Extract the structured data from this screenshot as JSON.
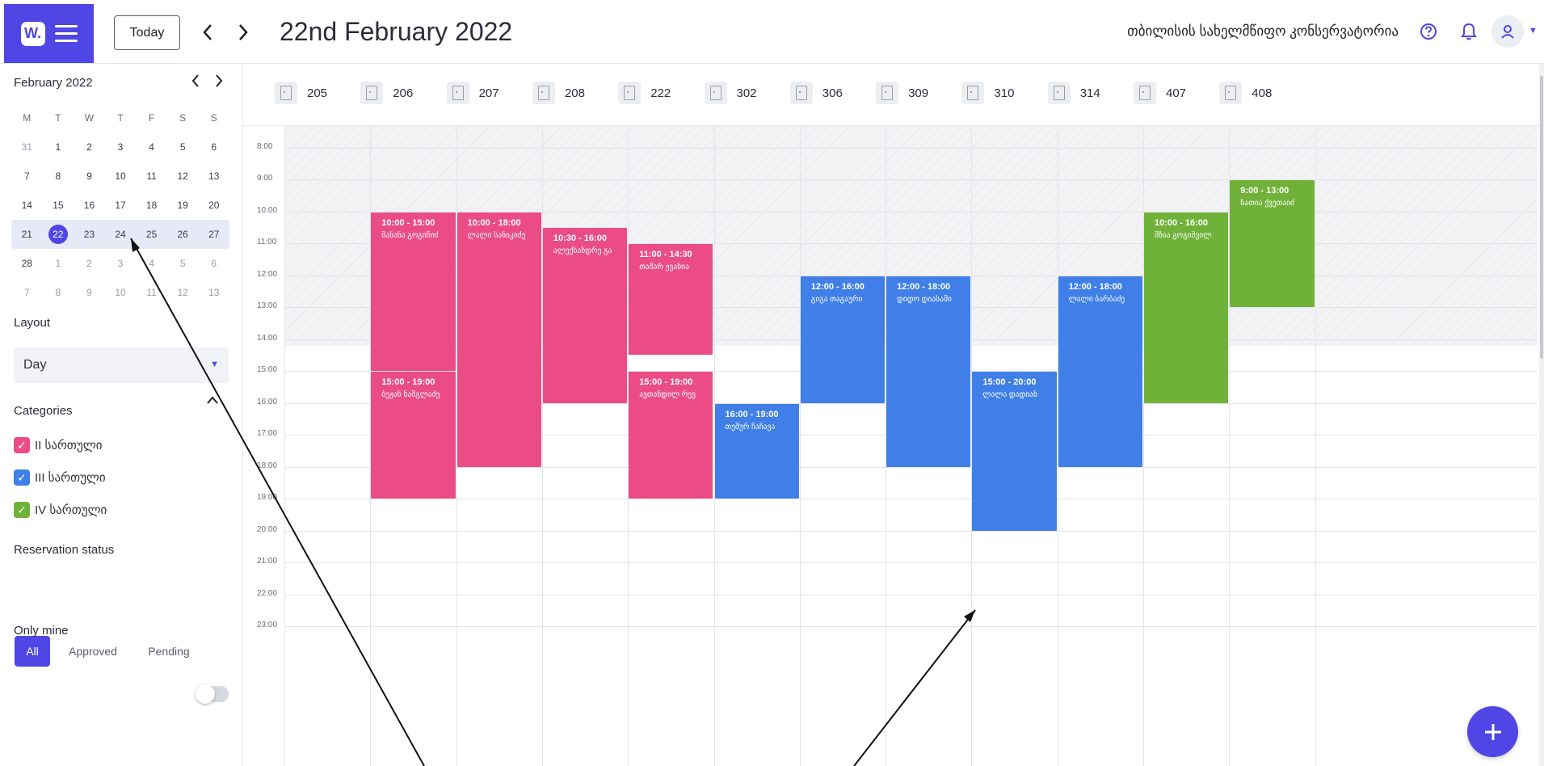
{
  "header": {
    "today_label": "Today",
    "date_title": "22nd February 2022",
    "org_name": "თბილისის სახელმწიფო კონსერვატორია",
    "icons": [
      "logo-icon",
      "menu-icon",
      "chevron-left-icon",
      "chevron-right-icon",
      "help-icon",
      "bell-icon",
      "user-icon"
    ]
  },
  "mini_calendar": {
    "month_title": "February 2022",
    "weekdays": [
      "M",
      "T",
      "W",
      "T",
      "F",
      "S",
      "S"
    ],
    "weeks": [
      [
        "31",
        "1",
        "2",
        "3",
        "4",
        "5",
        "6"
      ],
      [
        "7",
        "8",
        "9",
        "10",
        "11",
        "12",
        "13"
      ],
      [
        "14",
        "15",
        "16",
        "17",
        "18",
        "19",
        "20"
      ],
      [
        "21",
        "22",
        "23",
        "24",
        "25",
        "26",
        "27"
      ],
      [
        "28",
        "1",
        "2",
        "3",
        "4",
        "5",
        "6"
      ],
      [
        "7",
        "8",
        "9",
        "10",
        "11",
        "12",
        "13"
      ]
    ],
    "selected": "22"
  },
  "layout": {
    "label": "Layout",
    "value": "Day"
  },
  "categories": {
    "label": "Categories",
    "items": [
      {
        "label": "II სართული",
        "color": "#ec4c85"
      },
      {
        "label": "III სართული",
        "color": "#3f7fe7"
      },
      {
        "label": "IV სართული",
        "color": "#70b239"
      }
    ]
  },
  "reservation_status": {
    "label": "Reservation status",
    "options": [
      "All",
      "Approved",
      "Pending"
    ],
    "active": "All"
  },
  "only_mine": {
    "label": "Only mine",
    "on": false
  },
  "rooms": [
    "205",
    "206",
    "207",
    "208",
    "222",
    "302",
    "306",
    "309",
    "310",
    "314",
    "407",
    "408"
  ],
  "time_labels": [
    "8:00",
    "9:00",
    "10:00",
    "11:00",
    "12:00",
    "13:00",
    "14:00",
    "15:00",
    "16:00",
    "17:00",
    "18:00",
    "19:00",
    "20:00",
    "21:00",
    "22:00",
    "23:00"
  ],
  "events": [
    {
      "room": "206",
      "start": "10:00",
      "end": "15:00",
      "name": "მანანა გოგიჩიძ",
      "category": "II სართული"
    },
    {
      "room": "206",
      "start": "15:00",
      "end": "19:00",
      "name": "ბეჟან ნამგლაძე",
      "category": "II სართული"
    },
    {
      "room": "207",
      "start": "10:00",
      "end": "18:00",
      "name": "ლალი სანიკიძე",
      "category": "II სართული"
    },
    {
      "room": "208",
      "start": "10:30",
      "end": "16:00",
      "name": "ალექსანდრე გა",
      "category": "II სართული"
    },
    {
      "room": "222",
      "start": "11:00",
      "end": "14:30",
      "name": "თამარ ჟვანია",
      "category": "II სართული"
    },
    {
      "room": "222",
      "start": "15:00",
      "end": "19:00",
      "name": "ავთანდილ რევ",
      "category": "II სართული"
    },
    {
      "room": "302",
      "start": "16:00",
      "end": "19:00",
      "name": "თემურ ჩაჩავა",
      "category": "III სართული"
    },
    {
      "room": "306",
      "start": "12:00",
      "end": "16:00",
      "name": "გიგა თაგაური",
      "category": "III სართული"
    },
    {
      "room": "309",
      "start": "12:00",
      "end": "18:00",
      "name": "დიდო დიასამი",
      "category": "III სართული"
    },
    {
      "room": "310",
      "start": "15:00",
      "end": "20:00",
      "name": "ლალა დადიან",
      "category": "III სართული"
    },
    {
      "room": "314",
      "start": "12:00",
      "end": "18:00",
      "name": "ლალი ბარბაძე",
      "category": "III სართული"
    },
    {
      "room": "407",
      "start": "10:00",
      "end": "16:00",
      "name": "მზია გოგიშვილ",
      "category": "IV სართული"
    },
    {
      "room": "408",
      "start": "9:00",
      "end": "13:00",
      "name": "ნათია ქვეთაიძ",
      "category": "IV სართული"
    }
  ]
}
